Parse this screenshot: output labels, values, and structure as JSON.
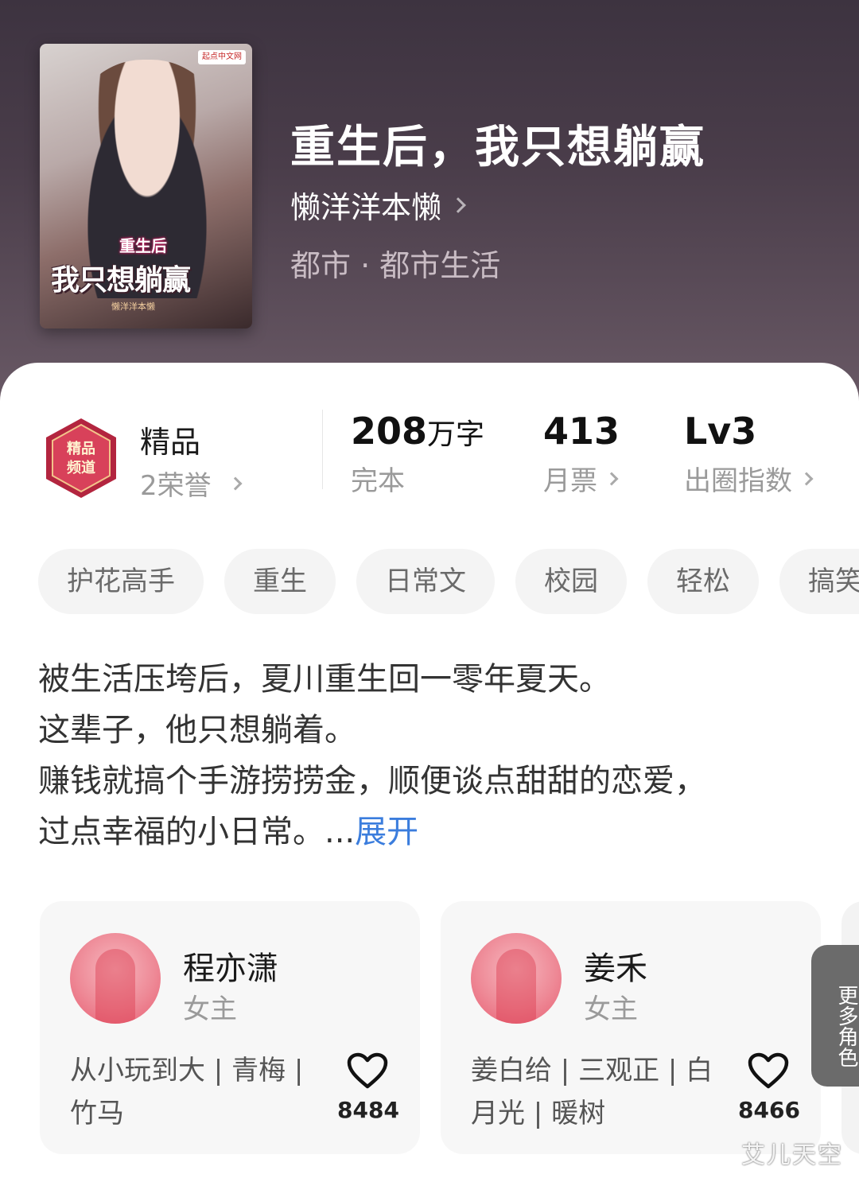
{
  "book": {
    "title": "重生后，我只想躺赢",
    "author": "懒洋洋本懒",
    "genre": "都市 · 都市生活",
    "cover": {
      "badge": "起点中文网",
      "sub_title": "重生后",
      "main_title": "我只想躺赢",
      "author_mark": "懒洋洋本懒"
    }
  },
  "honor": {
    "medal_text": "精品频道",
    "label": "精品",
    "sub": "2荣誉"
  },
  "stats": [
    {
      "value": "208",
      "unit": "万字",
      "label": "完本",
      "has_chevron": false
    },
    {
      "value": "413",
      "unit": "",
      "label": "月票",
      "has_chevron": true
    },
    {
      "value": "Lv3",
      "unit": "",
      "label": "出圈指数",
      "has_chevron": true
    }
  ],
  "tags": [
    "护花高手",
    "重生",
    "日常文",
    "校园",
    "轻松",
    "搞笑"
  ],
  "description": {
    "lines": [
      "被生活压垮后，夏川重生回一零年夏天。",
      "这辈子，他只想躺着。",
      "赚钱就搞个手游捞捞金，顺便谈点甜甜的恋爱，",
      "过点幸福的小日常。..."
    ],
    "expand_label": "展开"
  },
  "characters": [
    {
      "name": "程亦潇",
      "role": "女主",
      "tags": "从小玩到大 | 青梅 | 竹马",
      "likes": "8484"
    },
    {
      "name": "姜禾",
      "role": "女主",
      "tags": "姜白给 | 三观正 | 白月光 | 暖树",
      "likes": "8466"
    }
  ],
  "more_roles_label": "更多角色",
  "watermark": "艾儿天空",
  "colors": {
    "hero_bg": "#4a3d4a",
    "link": "#3b7ddd",
    "tag_bg": "#f4f4f4",
    "avatar": "#ee8a97"
  }
}
